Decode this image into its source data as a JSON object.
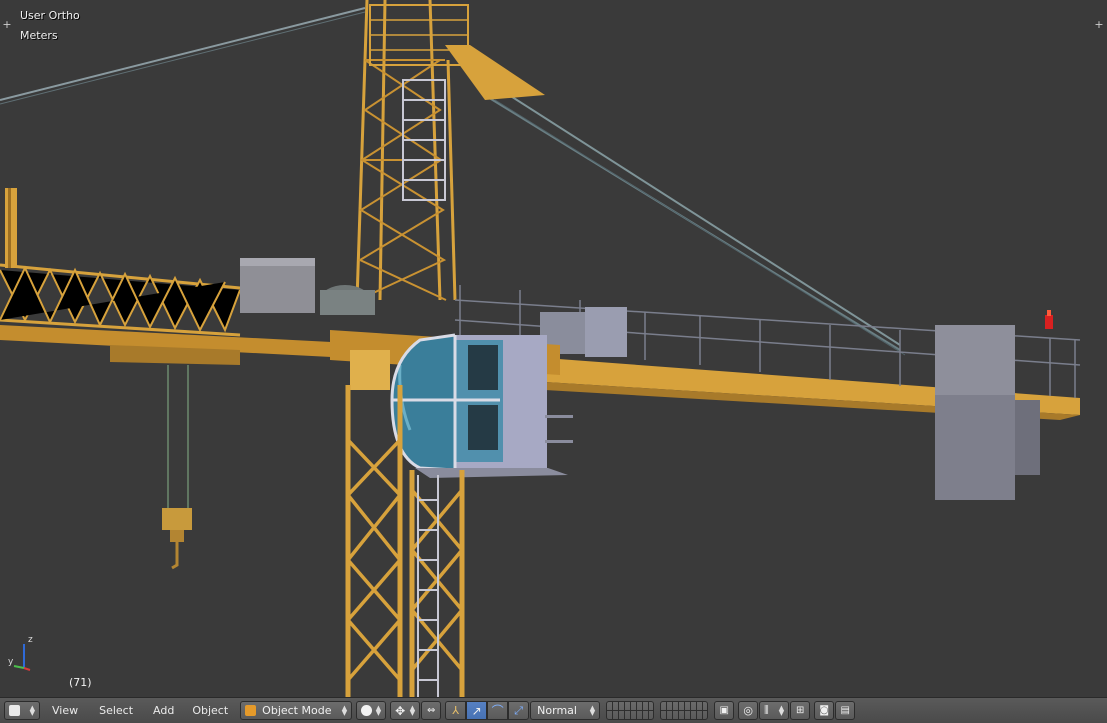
{
  "viewport": {
    "view_name": "User Ortho",
    "units": "Meters",
    "frame": "(71)",
    "axis_z": "z",
    "axis_y": "y"
  },
  "header": {
    "menus": [
      "View",
      "Select",
      "Add",
      "Object"
    ],
    "mode": "Object Mode",
    "orientation": "Normal"
  },
  "colors": {
    "crane": "#d7a23c",
    "background": "#3a3a3a",
    "accent": "#5680c2"
  }
}
